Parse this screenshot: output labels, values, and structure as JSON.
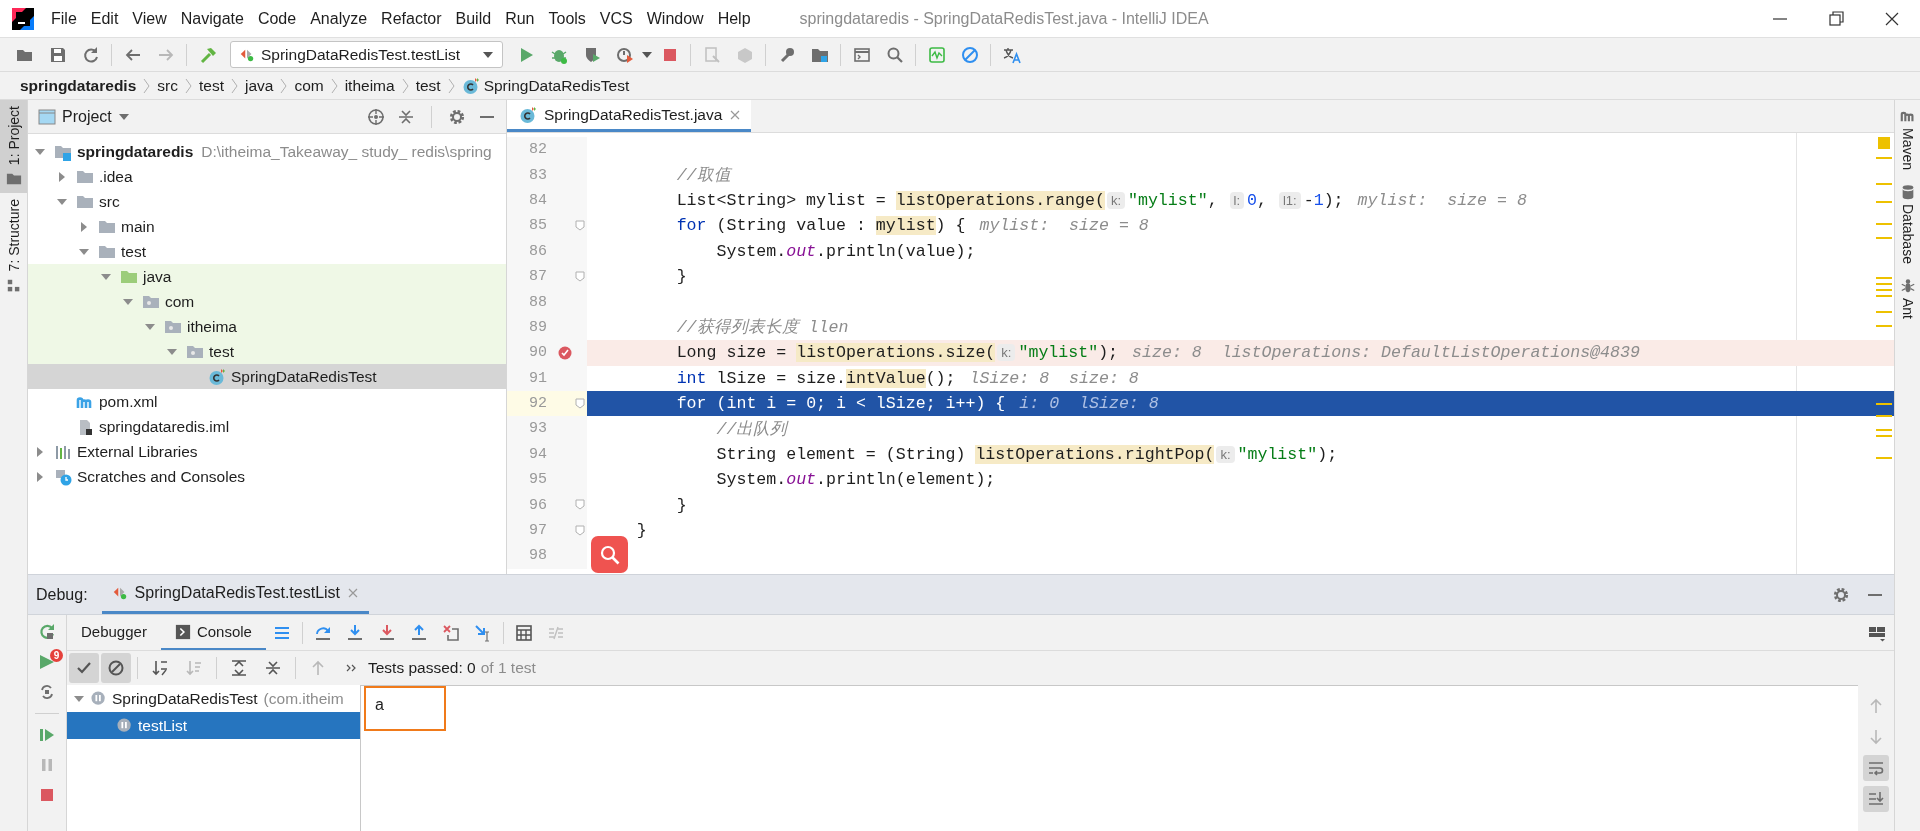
{
  "window": {
    "title": "springdataredis - SpringDataRedisTest.java - IntelliJ IDEA"
  },
  "menu": [
    "File",
    "Edit",
    "View",
    "Navigate",
    "Code",
    "Analyze",
    "Refactor",
    "Build",
    "Run",
    "Tools",
    "VCS",
    "Window",
    "Help"
  ],
  "toolbar": {
    "run_config": "SpringDataRedisTest.testList"
  },
  "breadcrumbs": [
    {
      "label": "springdataredis",
      "kind": "project"
    },
    {
      "label": "src",
      "kind": "folder"
    },
    {
      "label": "test",
      "kind": "folder"
    },
    {
      "label": "java",
      "kind": "folder"
    },
    {
      "label": "com",
      "kind": "folder"
    },
    {
      "label": "itheima",
      "kind": "folder"
    },
    {
      "label": "test",
      "kind": "folder"
    },
    {
      "label": "SpringDataRedisTest",
      "kind": "class"
    }
  ],
  "left_stripe": [
    {
      "label": "1: Project",
      "kind": "project",
      "selected": true
    },
    {
      "label": "7: Structure",
      "kind": "structure",
      "selected": false
    }
  ],
  "right_stripe": [
    {
      "label": "Maven",
      "kind": "maven"
    },
    {
      "label": "Database",
      "kind": "database"
    },
    {
      "label": "Ant",
      "kind": "ant"
    }
  ],
  "project": {
    "title": "Project",
    "tree": [
      {
        "label": "springdataredis",
        "path": "D:\\itheima_Takeaway_ study_ redis\\spring",
        "kind": "module",
        "expanded": true,
        "selected": false,
        "children": [
          {
            "label": ".idea",
            "kind": "folder",
            "expanded": false,
            "selected": false
          },
          {
            "label": "src",
            "kind": "folder",
            "expanded": true,
            "selected": false,
            "children": [
              {
                "label": "main",
                "kind": "folder",
                "expanded": false,
                "selected": false
              },
              {
                "label": "test",
                "kind": "folder",
                "expanded": true,
                "selected": false,
                "children": [
                  {
                    "label": "java",
                    "kind": "test-root",
                    "expanded": true,
                    "selected": false,
                    "children": [
                      {
                        "label": "com",
                        "kind": "package",
                        "expanded": true,
                        "selected": false,
                        "children": [
                          {
                            "label": "itheima",
                            "kind": "package",
                            "expanded": true,
                            "selected": false,
                            "children": [
                              {
                                "label": "test",
                                "kind": "package",
                                "expanded": true,
                                "selected": false,
                                "children": [
                                  {
                                    "label": "SpringDataRedisTest",
                                    "kind": "class",
                                    "selected": true
                                  }
                                ]
                              }
                            ]
                          }
                        ]
                      }
                    ]
                  }
                ]
              }
            ]
          },
          {
            "label": "pom.xml",
            "kind": "maven",
            "selected": false
          },
          {
            "label": "springdataredis.iml",
            "kind": "iml",
            "selected": false
          }
        ]
      },
      {
        "label": "External Libraries",
        "kind": "libraries",
        "expanded": false,
        "selected": false
      },
      {
        "label": "Scratches and Consoles",
        "kind": "scratches",
        "expanded": false,
        "selected": false
      }
    ]
  },
  "editor": {
    "tab": {
      "label": "SpringDataRedisTest.java",
      "selected": true
    },
    "lines": [
      {
        "number": "82",
        "kind": "plain",
        "fold": false
      },
      {
        "number": "83",
        "kind": "plain",
        "fold": false,
        "tokens": [
          {
            "text": "        //取值",
            "kind": "comment"
          }
        ]
      },
      {
        "number": "84",
        "kind": "plain",
        "fold": false,
        "tokens": [
          {
            "text": "        List<String> mylist = ",
            "kind": "plain"
          },
          {
            "text": "listOperations.range(",
            "kind": "usage"
          },
          {
            "text": "k:",
            "kind": "hint"
          },
          {
            "text": "\"mylist\"",
            "kind": "string"
          },
          {
            "text": ", ",
            "kind": "plain"
          },
          {
            "text": "l:",
            "kind": "hint"
          },
          {
            "text": "0",
            "kind": "number"
          },
          {
            "text": ", ",
            "kind": "plain"
          },
          {
            "text": "l1:",
            "kind": "hint"
          },
          {
            "text": "-",
            "kind": "plain"
          },
          {
            "text": "1",
            "kind": "number"
          },
          {
            "text": ");",
            "kind": "plain"
          }
        ],
        "value": "mylist:  size = 8"
      },
      {
        "number": "85",
        "kind": "plain",
        "fold": true,
        "tokens": [
          {
            "text": "        for",
            "kind": "keyword"
          },
          {
            "text": " (String value : ",
            "kind": "plain"
          },
          {
            "text": "mylist",
            "kind": "usage"
          },
          {
            "text": ") {",
            "kind": "plain"
          }
        ],
        "value": "mylist:  size = 8"
      },
      {
        "number": "86",
        "kind": "plain",
        "fold": false,
        "tokens": [
          {
            "text": "            System.",
            "kind": "plain"
          },
          {
            "text": "out",
            "kind": "field"
          },
          {
            "text": ".println(value);",
            "kind": "plain"
          }
        ]
      },
      {
        "number": "87",
        "kind": "plain",
        "fold": true,
        "tokens": [
          {
            "text": "        }",
            "kind": "plain"
          }
        ]
      },
      {
        "number": "88",
        "kind": "plain",
        "fold": false
      },
      {
        "number": "89",
        "kind": "plain",
        "fold": false,
        "tokens": [
          {
            "text": "        //获得列表长度 llen",
            "kind": "comment"
          }
        ]
      },
      {
        "number": "90",
        "kind": "breakpoint",
        "fold": false,
        "tokens": [
          {
            "text": "        Long size = ",
            "kind": "plain"
          },
          {
            "text": "listOperations.size(",
            "kind": "usage"
          },
          {
            "text": "k:",
            "kind": "hint"
          },
          {
            "text": "\"mylist\"",
            "kind": "string"
          },
          {
            "text": ");",
            "kind": "plain"
          }
        ],
        "value": "size: 8  listOperations: DefaultListOperations@4839"
      },
      {
        "number": "91",
        "kind": "plain",
        "fold": false,
        "tokens": [
          {
            "text": "        int",
            "kind": "keyword"
          },
          {
            "text": " lSize = size.",
            "kind": "plain"
          },
          {
            "text": "intValue",
            "kind": "usage"
          },
          {
            "text": "();",
            "kind": "plain"
          }
        ],
        "value": "lSize: 8  size: 8"
      },
      {
        "number": "92",
        "kind": "execution",
        "fold": true,
        "tokens": [
          {
            "text": "        for",
            "kind": "keyword"
          },
          {
            "text": " (",
            "kind": "plain"
          },
          {
            "text": "int",
            "kind": "keyword"
          },
          {
            "text": " i = 0; i < lSize; i++) {",
            "kind": "plain"
          }
        ],
        "value": "i: 0  lSize: 8"
      },
      {
        "number": "93",
        "kind": "plain",
        "fold": false,
        "tokens": [
          {
            "text": "            //出队列",
            "kind": "comment"
          }
        ]
      },
      {
        "number": "94",
        "kind": "plain",
        "fold": false,
        "tokens": [
          {
            "text": "            String element = (String) ",
            "kind": "plain"
          },
          {
            "text": "listOperations.rightPop(",
            "kind": "usage"
          },
          {
            "text": "k:",
            "kind": "hint"
          },
          {
            "text": "\"mylist\"",
            "kind": "string"
          },
          {
            "text": ");",
            "kind": "plain"
          }
        ]
      },
      {
        "number": "95",
        "kind": "plain",
        "fold": false,
        "tokens": [
          {
            "text": "            System.",
            "kind": "plain"
          },
          {
            "text": "out",
            "kind": "field"
          },
          {
            "text": ".println(element);",
            "kind": "plain"
          }
        ]
      },
      {
        "number": "96",
        "kind": "plain",
        "fold": true,
        "tokens": [
          {
            "text": "        }",
            "kind": "plain"
          }
        ]
      },
      {
        "number": "97",
        "kind": "plain",
        "fold": true,
        "tokens": [
          {
            "text": "    }",
            "kind": "plain"
          }
        ]
      },
      {
        "number": "98",
        "kind": "plain",
        "fold": false
      }
    ]
  },
  "debug": {
    "label": "Debug:",
    "session_tab": {
      "label": "SpringDataRedisTest.testList",
      "selected": true
    },
    "badge": "9",
    "tabs": [
      {
        "label": "Debugger",
        "selected": false
      },
      {
        "label": "Console",
        "selected": true
      }
    ],
    "filters": [
      {
        "kind": "passed",
        "on": true
      },
      {
        "kind": "ignored",
        "on": true
      }
    ],
    "status": {
      "passed": "Tests passed: 0",
      "total": "of 1 test"
    },
    "tests": [
      {
        "label": "SpringDataRedisTest",
        "detail": "(com.itheim",
        "expanded": true,
        "selected": false,
        "children": [
          {
            "label": "testList",
            "selected": true
          }
        ]
      }
    ],
    "console": {
      "lines": [
        "a"
      ],
      "highlight": true
    },
    "console_tools": [
      {
        "kind": "up",
        "on": false
      },
      {
        "kind": "down",
        "on": false
      },
      {
        "kind": "wrap",
        "on": true
      },
      {
        "kind": "scroll-end",
        "on": true
      }
    ]
  }
}
